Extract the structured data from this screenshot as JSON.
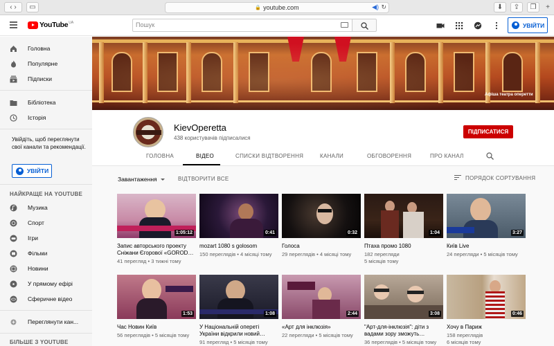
{
  "browser": {
    "url": "youtube.com"
  },
  "header": {
    "logo_text": "YouTube",
    "logo_region": "UA",
    "search_placeholder": "Пошук",
    "signin_label": "УВІЙТИ"
  },
  "sidebar": {
    "main": [
      {
        "label": "Головна",
        "icon": "home-icon"
      },
      {
        "label": "Популярне",
        "icon": "fire-icon"
      },
      {
        "label": "Підписки",
        "icon": "subscriptions-icon"
      }
    ],
    "library": [
      {
        "label": "Бібліотека",
        "icon": "folder-icon"
      },
      {
        "label": "Історія",
        "icon": "history-icon"
      }
    ],
    "signin_prompt": "Увійдіть, щоб переглянути свої канали та рекомендації.",
    "signin_label": "УВІЙТИ",
    "best_heading": "НАЙКРАЩЕ НА YOUTUBE",
    "best": [
      {
        "label": "Музика",
        "icon": "music-icon"
      },
      {
        "label": "Спорт",
        "icon": "sport-icon"
      },
      {
        "label": "Ігри",
        "icon": "games-icon"
      },
      {
        "label": "Фільми",
        "icon": "movies-icon"
      },
      {
        "label": "Новини",
        "icon": "news-icon"
      },
      {
        "label": "У прямому ефірі",
        "icon": "live-icon"
      },
      {
        "label": "Сферичне відео",
        "icon": "360-icon"
      }
    ],
    "browse_channels": "Переглянути кан...",
    "more_heading": "БІЛЬШЕ З YOUTUBE"
  },
  "banner": {
    "caption": "Афіша театра оперетти"
  },
  "channel": {
    "name": "KievOperetta",
    "subscribers": "438 користувачів підписалися",
    "subscribe_label": "ПІДПИСАТИСЯ"
  },
  "tabs": [
    "ГОЛОВНА",
    "ВІДЕО",
    "СПИСКИ ВІДТВОРЕННЯ",
    "КАНАЛИ",
    "ОБГОВОРЕННЯ",
    "ПРО КАНАЛ"
  ],
  "active_tab": "ВІДЕО",
  "toolbar": {
    "uploads_label": "Завантаження",
    "play_all": "ВІДТВОРИТИ ВСЕ",
    "sort_label": "ПОРЯДОК СОРТУВАННЯ"
  },
  "videos": [
    {
      "title": "Запис авторського проекту Сніжани Єгорової «GOROD…",
      "duration": "1:05:12",
      "views": "41 перегляд",
      "age": "3 тижні тому"
    },
    {
      "title": "mozart 1080 s golosom",
      "duration": "0:41",
      "views": "150 переглядів",
      "age": "4 місяці тому"
    },
    {
      "title": "Голоса",
      "duration": "0:32",
      "views": "29 переглядів",
      "age": "4 місяці тому"
    },
    {
      "title": "Птаха промо 1080",
      "duration": "1:04",
      "views": "182 перегляди",
      "age": "5 місяців тому"
    },
    {
      "title": "Київ Live",
      "duration": "3:27",
      "views": "24 перегляди",
      "age": "5 місяців тому"
    },
    {
      "title": "Час Новин Київ",
      "duration": "1:53",
      "views": "56 переглядів",
      "age": "5 місяців тому"
    },
    {
      "title": "У Національній опереті України відкрили новий…",
      "duration": "1:08",
      "views": "91 перегляд",
      "age": "5 місяців тому"
    },
    {
      "title": "«Арт для інклюзія»",
      "duration": "2:44",
      "views": "22 перегляди",
      "age": "5 місяців тому"
    },
    {
      "title": "\"Арт-для-інклюзія\": діти з вадами зору зможуть…",
      "duration": "3:08",
      "views": "36 переглядів",
      "age": "5 місяців тому"
    },
    {
      "title": "Хочу в Париж",
      "duration": "0:46",
      "views": "158 переглядів",
      "age": "6 місяців тому"
    }
  ]
}
